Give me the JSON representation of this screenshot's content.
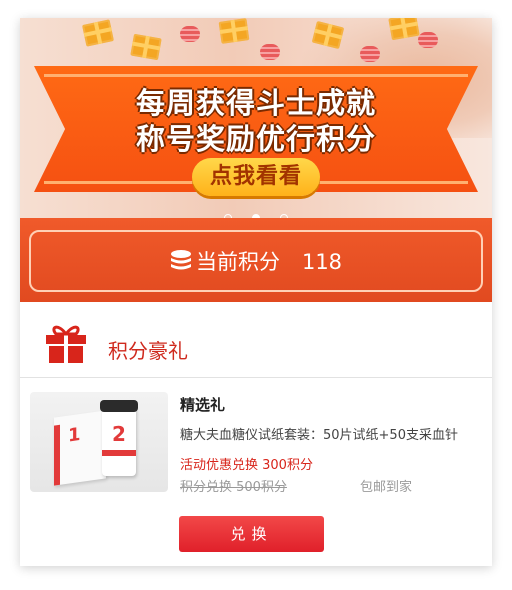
{
  "banner": {
    "line1": "每周获得斗士成就",
    "line2": "称号奖励优行积分",
    "cta": "点我看看",
    "slide_count": 3,
    "active_slide": 2
  },
  "points": {
    "icon": "coin-stack-icon",
    "label": "当前积分",
    "value": "118"
  },
  "section": {
    "icon": "gift-icon",
    "title": "积分豪礼"
  },
  "product": {
    "name": "精选礼",
    "description": "糖大夫血糖仪试纸套装：50片试纸+50支采血针",
    "promo_price": "活动优惠兑换 300积分",
    "original_price": "积分兑换 500积分",
    "shipping": "包邮到家",
    "redeem_label": "兑换"
  },
  "colors": {
    "accent_red": "#d8251b",
    "banner_orange": "#f55012",
    "button_yellow": "#ffc22f"
  }
}
